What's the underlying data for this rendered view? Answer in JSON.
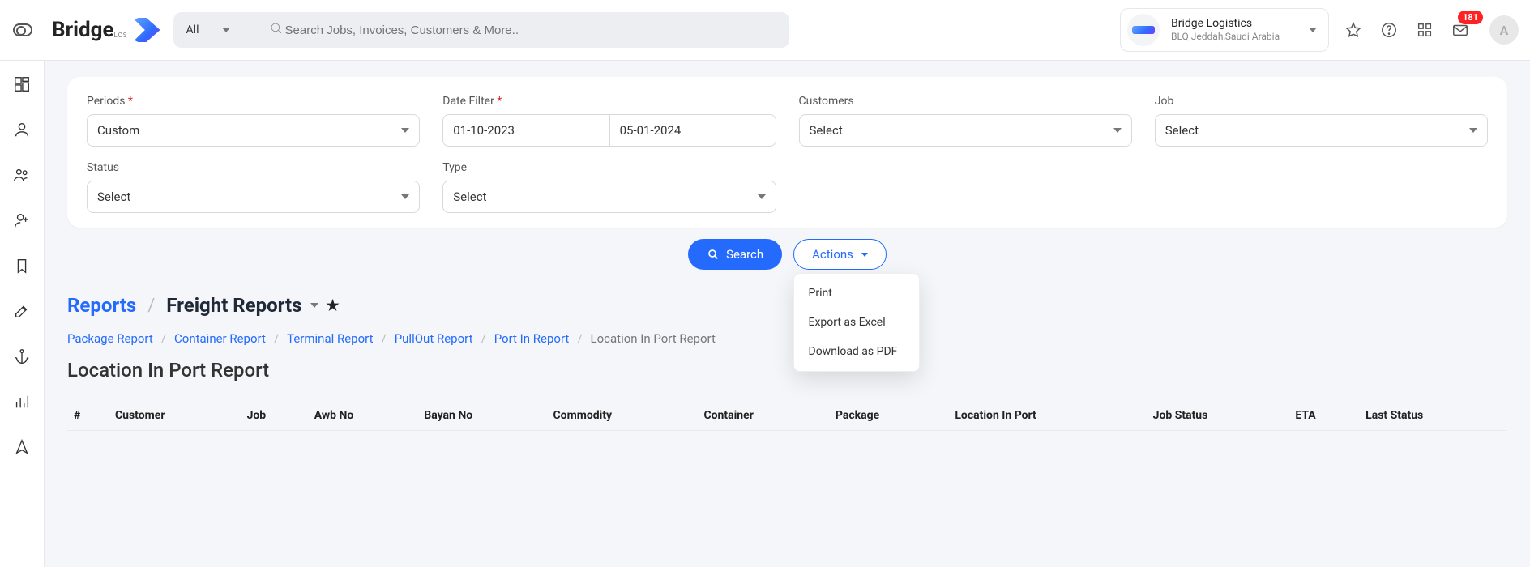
{
  "topbar": {
    "logo_text": "Bridge",
    "logo_sub": "LCS",
    "search_selector": "All",
    "search_placeholder": "Search Jobs, Invoices, Customers & More..",
    "company_name": "Bridge Logistics",
    "company_sub": "BLQ Jeddah,Saudi Arabia",
    "mail_badge": "181",
    "avatar_letter": "A"
  },
  "filters": {
    "periods": {
      "label": "Periods",
      "value": "Custom"
    },
    "dateFilter": {
      "label": "Date Filter",
      "from": "01-10-2023",
      "to": "05-01-2024"
    },
    "customers": {
      "label": "Customers",
      "value": "Select"
    },
    "job": {
      "label": "Job",
      "value": "Select"
    },
    "status": {
      "label": "Status",
      "value": "Select"
    },
    "type": {
      "label": "Type",
      "value": "Select"
    }
  },
  "buttons": {
    "search": "Search",
    "actions": "Actions"
  },
  "actions_menu": [
    "Print",
    "Export as Excel",
    "Download as PDF"
  ],
  "page": {
    "root": "Reports",
    "group": "Freight Reports"
  },
  "subnav": [
    "Package Report",
    "Container Report",
    "Terminal Report",
    "PullOut Report",
    "Port In Report",
    "Location In Port Report"
  ],
  "report_title": "Location In Port Report",
  "columns": [
    "#",
    "Customer",
    "Job",
    "Awb No",
    "Bayan No",
    "Commodity",
    "Container",
    "Package",
    "Location In Port",
    "Job Status",
    "ETA",
    "Last Status"
  ]
}
